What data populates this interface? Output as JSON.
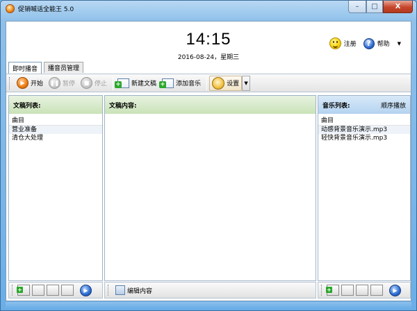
{
  "window": {
    "title": "促销喊话全能王 5.0",
    "buttons": {
      "minimize": "–",
      "maximize": "□",
      "close": "X"
    }
  },
  "header": {
    "time": "14:15",
    "date": "2016-08-24，星期三",
    "register_label": "注册",
    "help_label": "帮助",
    "menu_caret": "▼"
  },
  "tabs": [
    {
      "label": "即时播音",
      "active": true
    },
    {
      "label": "播音员管理",
      "active": false
    }
  ],
  "toolbar": {
    "start": "开始",
    "pause": "暂停",
    "stop": "停止",
    "new_doc": "新建文稿",
    "add_music": "添加音乐",
    "settings": "设置",
    "settings_caret": "▼"
  },
  "panes": {
    "docs": {
      "title": "文稿列表:",
      "column": "曲目",
      "items": [
        "营业准备",
        "清仓大处理"
      ]
    },
    "content": {
      "title": "文稿内容:"
    },
    "music": {
      "title": "音乐列表:",
      "mode": "顺序播放",
      "column": "曲目",
      "items": [
        "动感背景音乐演示.mp3",
        "轻快背景音乐演示.mp3"
      ]
    }
  },
  "bottom": {
    "edit_content": "编辑内容",
    "next_glyph": "▶"
  },
  "colors": {
    "frame": "#6aaee8",
    "docs_header": "#c9e2b8",
    "music_header": "#b4d3f0",
    "start_orange": "#ee7a10"
  }
}
